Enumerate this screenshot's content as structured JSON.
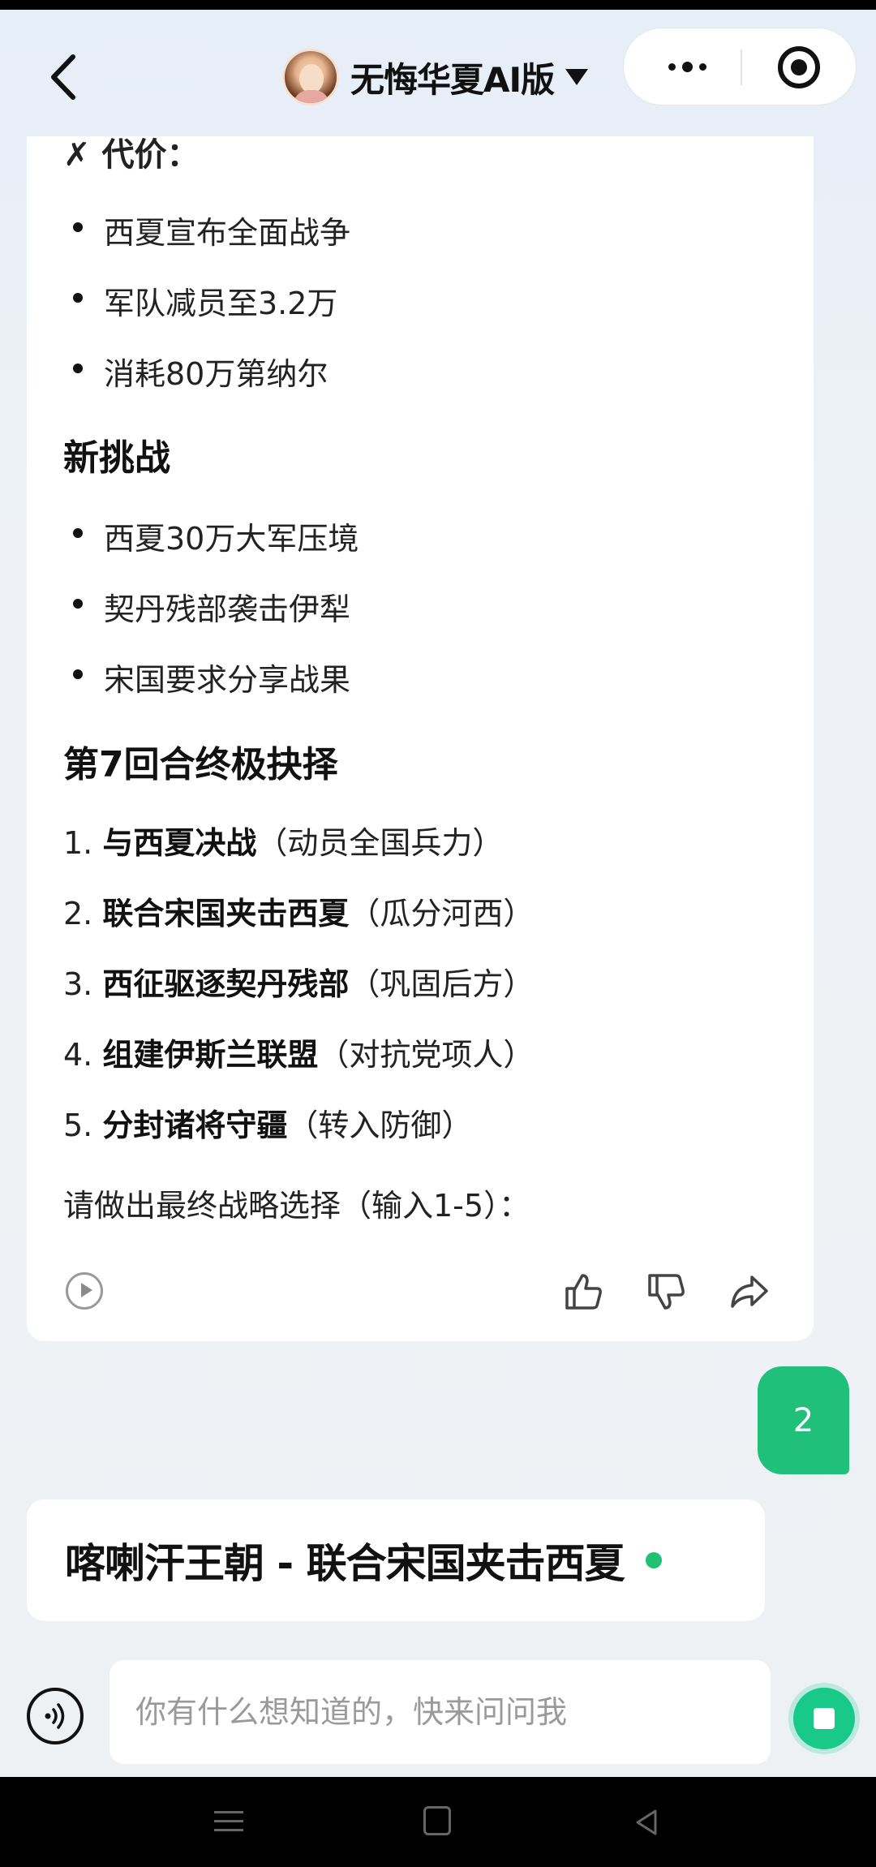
{
  "header": {
    "title": "无悔华夏AI版",
    "avatar_icon": "character-avatar",
    "back_icon": "chevron-left-icon",
    "more_icon": "more-dots-icon",
    "target_icon": "record-target-icon"
  },
  "message": {
    "cutoff_line": "✗ 代价：",
    "cost_items": [
      "西夏宣布全面战争",
      "军队减员至3.2万",
      "消耗80万第纳尔"
    ],
    "challenge_heading": "新挑战",
    "challenge_items": [
      "西夏30万大军压境",
      "契丹残部袭击伊犁",
      "宋国要求分享战果"
    ],
    "choice_heading": "第7回合终极抉择",
    "options": [
      {
        "num": "1.",
        "title": "与西夏决战",
        "note": "（动员全国兵力）"
      },
      {
        "num": "2.",
        "title": "联合宋国夹击西夏",
        "note": "（瓜分河西）"
      },
      {
        "num": "3.",
        "title": "西征驱逐契丹残部",
        "note": "（巩固后方）"
      },
      {
        "num": "4.",
        "title": "组建伊斯兰联盟",
        "note": "（对抗党项人）"
      },
      {
        "num": "5.",
        "title": "分封诸将守疆",
        "note": "（转入防御）"
      }
    ],
    "prompt": "请做出最终战略选择（输入1-5）："
  },
  "user_reply": "2",
  "status_card": {
    "title": "喀喇汗王朝 - 联合宋国夹击西夏"
  },
  "input": {
    "placeholder": "你有什么想知道的，快来问问我"
  },
  "colors": {
    "accent": "#21c07a",
    "background": "#eef2f6"
  }
}
